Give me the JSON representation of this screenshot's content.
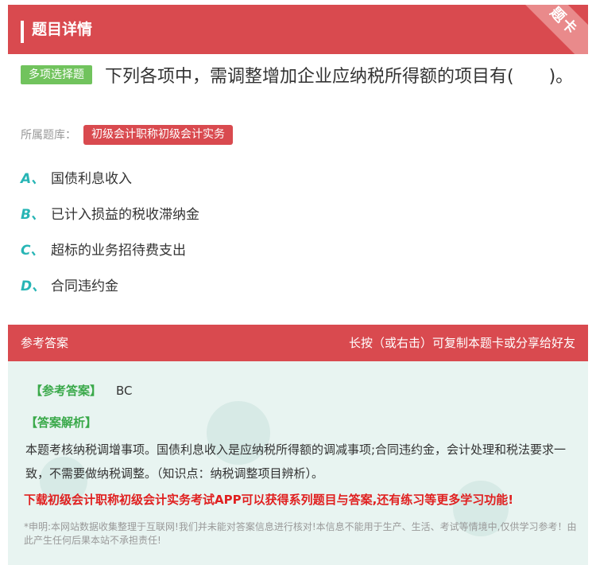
{
  "header": {
    "title": "题目详情",
    "corner_label": "题卡"
  },
  "question": {
    "type_label": "多项选择题",
    "text": "下列各项中，需调整增加企业应纳税所得额的项目有(　　)。",
    "library_label": "所属题库：",
    "library_name": "初级会计职称初级会计实务"
  },
  "options": [
    {
      "letter": "A、",
      "text": "国债利息收入"
    },
    {
      "letter": "B、",
      "text": "已计入损益的税收滞纳金"
    },
    {
      "letter": "C、",
      "text": "超标的业务招待费支出"
    },
    {
      "letter": "D、",
      "text": "合同违约金"
    }
  ],
  "answer_bar": {
    "left_label": "参考答案",
    "right_label": "长按（或右击）可复制本题卡或分享给好友"
  },
  "answer": {
    "answer_label": "【参考答案】",
    "answer_value": "BC",
    "analysis_label": "【答案解析】",
    "analysis_text": "本题考核纳税调增事项。国债利息收入是应纳税所得额的调减事项;合同违约金，会计处理和税法要求一致，不需要做纳税调整。（知识点：纳税调整项目辨析）。",
    "download_text": "下载初级会计职称初级会计实务考试APP可以获得系列题目与答案,还有练习等更多学习功能!",
    "disclaimer": "*申明:本网站数据收集整理于互联网!我们并未能对答案信息进行核对!本信息不能用于生产、生活、考试等情境中,仅供学习参考！由此产生任何后果本站不承担责任!"
  },
  "colors": {
    "accent_red": "#d94a4f",
    "option_letter": "#27b5b5",
    "type_green": "#71c35d",
    "answer_green": "#3aa94a",
    "answer_bg": "#e8f4f1"
  }
}
